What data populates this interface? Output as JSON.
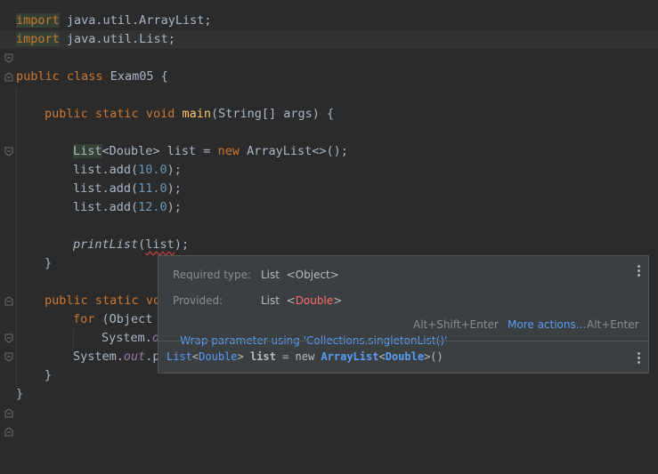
{
  "editor": {
    "l1": {
      "kw": "import",
      "rest": " java.util.ArrayList;"
    },
    "l2": {
      "kw": "import",
      "rest": " java.util.List;"
    },
    "l4": {
      "kw1": "public",
      "kw2": "class",
      "rest": " Exam05 {"
    },
    "l6": {
      "kw1": "public",
      "kw2": "static",
      "kw3": "void",
      "fn": "main",
      "rest": "(String[] args) {"
    },
    "l8": {
      "type": "List",
      "rest1": "<Double> list = ",
      "kw": "new",
      "rest2": " ArrayList<>();"
    },
    "l9": {
      "pre": "list.add(",
      "num": "10.0",
      "post": ");"
    },
    "l10": {
      "pre": "list.add(",
      "num": "11.0",
      "post": ");"
    },
    "l11": {
      "pre": "list.add(",
      "num": "12.0",
      "post": ");"
    },
    "l13": {
      "fn": "printList",
      "open": "(",
      "arg": "list",
      "close": ");"
    },
    "l14": {
      "text": "}"
    },
    "l16": {
      "kw1": "public",
      "kw2": "static",
      "rest": " vo"
    },
    "l17": {
      "kw": "for",
      "rest": " (Object"
    },
    "l18": {
      "pre": "System.",
      "field": "o"
    },
    "l19": {
      "pre": "System.",
      "field": "out",
      "post": ".p"
    },
    "l20": {
      "text": "}"
    },
    "l21": {
      "text": "}"
    }
  },
  "popup": {
    "required_label": "Required type:",
    "required_type": "List",
    "required_param": "<Object>",
    "provided_label": "Provided:",
    "provided_type": "List",
    "provided_param_open": "<",
    "provided_param": "Double",
    "provided_param_close": ">",
    "fix_action": "Wrap parameter using 'Collections.singletonList()'",
    "fix_shortcut": "Alt+Shift+Enter",
    "more_actions": "More actions...",
    "more_shortcut": "Alt+Enter",
    "decl": {
      "type": "List",
      "lt1": "<",
      "param": "Double",
      "gt1": ">",
      "var": " list",
      "eq": " = new ",
      "ctor": "ArrayList",
      "lt2": "<",
      "param2": "Double",
      "gt2": ">",
      "tail": "()"
    }
  },
  "colors": {
    "background": "#2b2b2b",
    "keyword": "#cc7832",
    "function": "#ffc66d",
    "number": "#6897bb",
    "error": "#ff6b68",
    "link": "#589df6"
  }
}
